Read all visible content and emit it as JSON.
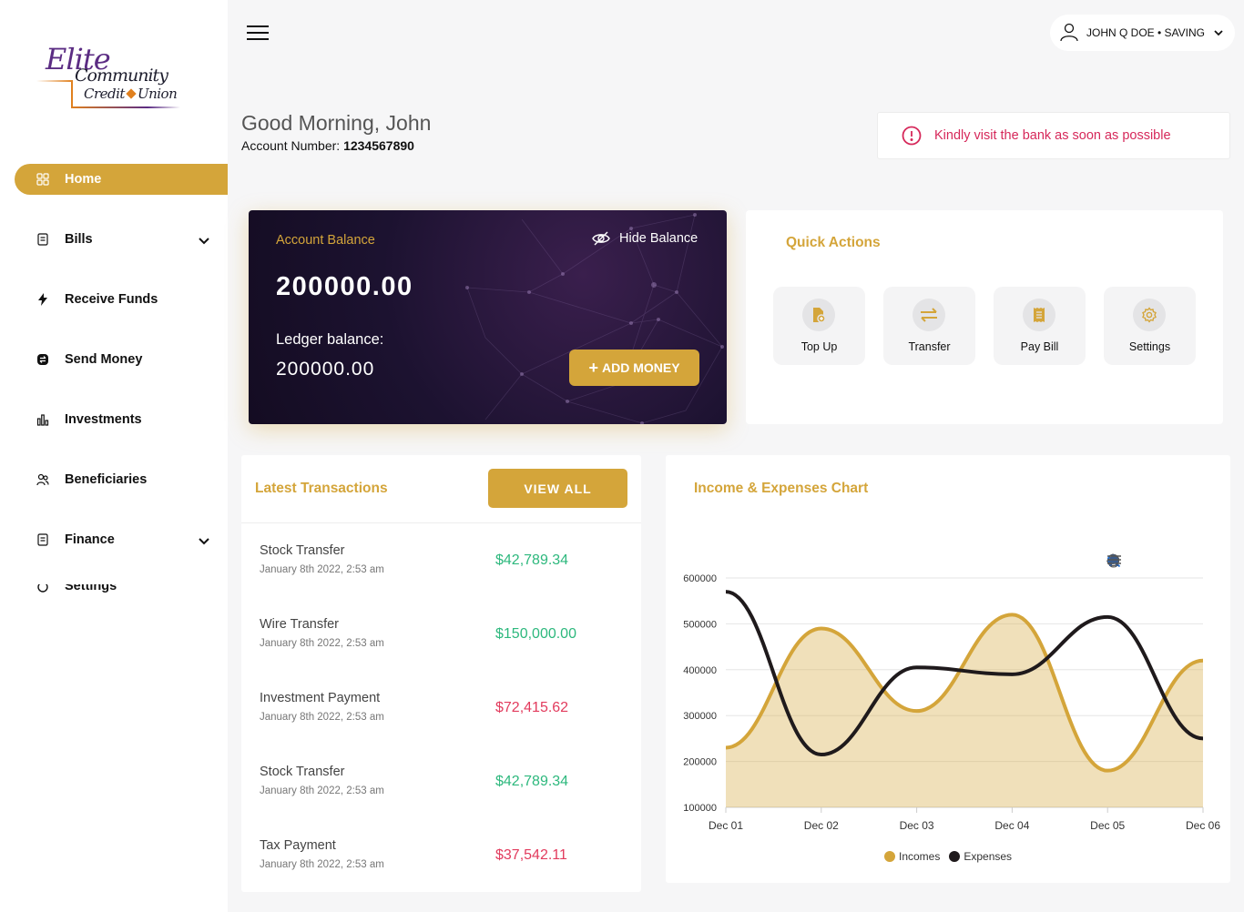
{
  "logo": {
    "line1": "Elite",
    "line2": "Community",
    "line3a": "Credit",
    "line3b": "Union"
  },
  "sidebar": {
    "items": [
      {
        "label": "Home",
        "icon": "grid-icon",
        "active": true
      },
      {
        "label": "Bills",
        "icon": "receipt-icon",
        "expandable": true
      },
      {
        "label": "Receive Funds",
        "icon": "bolt-icon"
      },
      {
        "label": "Send Money",
        "icon": "send-icon"
      },
      {
        "label": "Investments",
        "icon": "bar-chart-icon"
      },
      {
        "label": "Beneficiaries",
        "icon": "users-icon"
      },
      {
        "label": "Finance",
        "icon": "receipt-icon",
        "expandable": true
      },
      {
        "label": "Settings",
        "icon": "gear-icon"
      }
    ]
  },
  "header": {
    "user_label": "JOHN Q DOE • SAVING"
  },
  "greeting": {
    "title": "Good Morning, John",
    "account_prefix": "Account Number:",
    "account_number": "1234567890"
  },
  "alert": {
    "text": "Kindly visit the bank as soon as possible"
  },
  "balance_card": {
    "title": "Account Balance",
    "hide_label": "Hide Balance",
    "amount": "200000.00",
    "ledger_label": "Ledger balance:",
    "ledger_amount": "200000.00",
    "add_money_label": "ADD MONEY"
  },
  "quick_actions": {
    "title": "Quick Actions",
    "items": [
      {
        "label": "Top Up",
        "icon": "topup-icon"
      },
      {
        "label": "Transfer",
        "icon": "transfer-icon"
      },
      {
        "label": "Pay Bill",
        "icon": "bill-icon"
      },
      {
        "label": "Settings",
        "icon": "gear-icon"
      }
    ]
  },
  "transactions": {
    "title": "Latest Transactions",
    "view_all_label": "VIEW ALL",
    "rows": [
      {
        "title": "Stock Transfer",
        "date": "January 8th 2022, 2:53 am",
        "amount": "$42,789.34",
        "type": "credit"
      },
      {
        "title": "Wire Transfer",
        "date": "January 8th 2022, 2:53 am",
        "amount": "$150,000.00",
        "type": "credit"
      },
      {
        "title": "Investment Payment",
        "date": "January 8th 2022, 2:53 am",
        "amount": "$72,415.62",
        "type": "debit"
      },
      {
        "title": "Stock Transfer",
        "date": "January 8th 2022, 2:53 am",
        "amount": "$42,789.34",
        "type": "credit"
      },
      {
        "title": "Tax Payment",
        "date": "January 8th 2022, 2:53 am",
        "amount": "$37,542.11",
        "type": "debit"
      }
    ]
  },
  "colors": {
    "accent": "#d4a53a",
    "credit": "#2db87d",
    "debit": "#e23b5d",
    "expenses": "#1f1a1c"
  },
  "chart_data": {
    "type": "area",
    "title": "Income & Expenses Chart",
    "categories": [
      "Dec 01",
      "Dec 02",
      "Dec 03",
      "Dec 04",
      "Dec 05",
      "Dec 06"
    ],
    "series": [
      {
        "name": "Incomes",
        "values": [
          230000,
          490000,
          310000,
          520000,
          180000,
          420000
        ],
        "color": "#d4a53a",
        "style": "area"
      },
      {
        "name": "Expenses",
        "values": [
          570000,
          215000,
          405000,
          390000,
          515000,
          250000
        ],
        "color": "#1f1a1c",
        "style": "line"
      }
    ],
    "yticks": [
      100000,
      200000,
      300000,
      400000,
      500000,
      600000
    ],
    "ylim": [
      100000,
      600000
    ],
    "grid": true,
    "legend": "bottom-center",
    "toolbar": [
      "zoom-in-icon",
      "zoom-out-icon",
      "magnifier-icon",
      "pan-hand-icon",
      "home-icon",
      "menu-icon"
    ]
  }
}
